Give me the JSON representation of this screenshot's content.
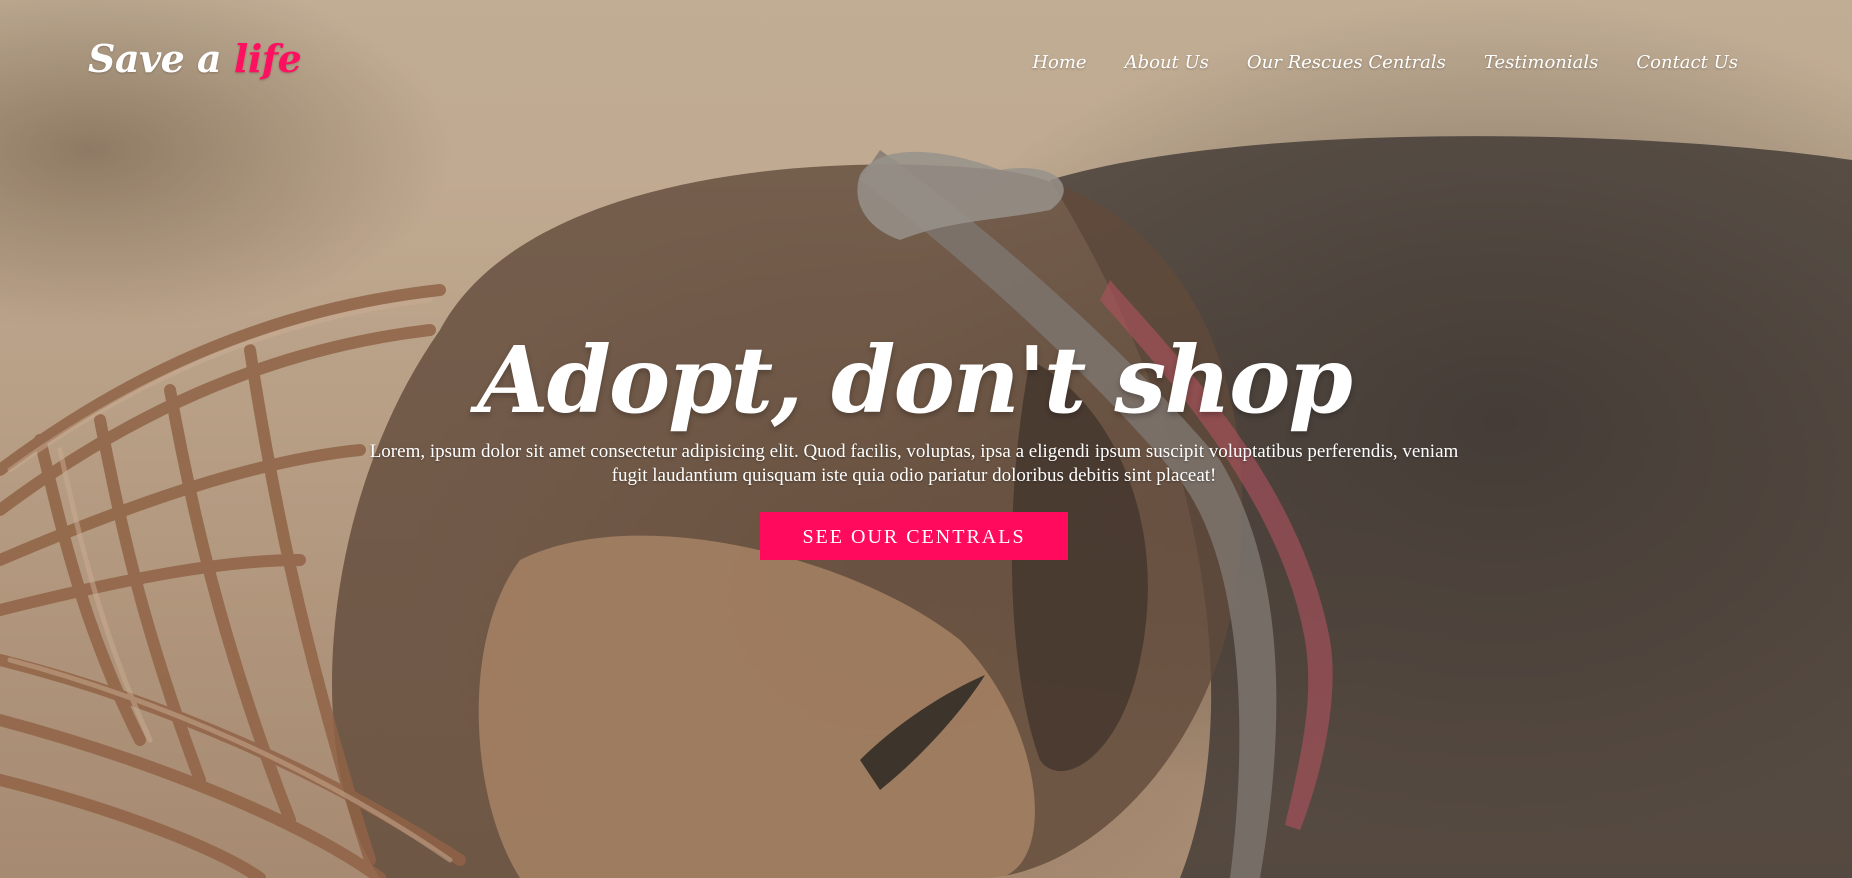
{
  "header": {
    "logo_text": "Save a",
    "logo_accent": "life"
  },
  "nav": {
    "items": [
      {
        "label": "Home"
      },
      {
        "label": "About Us"
      },
      {
        "label": "Our Rescues Centrals"
      },
      {
        "label": "Testimonials"
      },
      {
        "label": "Contact Us"
      }
    ]
  },
  "hero": {
    "headline": "Adopt, don't shop",
    "subtitle": "Lorem, ipsum dolor sit amet consectetur adipisicing elit. Quod facilis, voluptas, ipsa a eligendi ipsum suscipit voluptatibus perferendis, veniam fugit laudantium quisquam iste quia odio pariatur doloribus debitis sint placeat!",
    "cta_label": "SEE OUR CENTRALS"
  },
  "colors": {
    "accent": "#ff0a5c",
    "text": "#ffffff"
  }
}
